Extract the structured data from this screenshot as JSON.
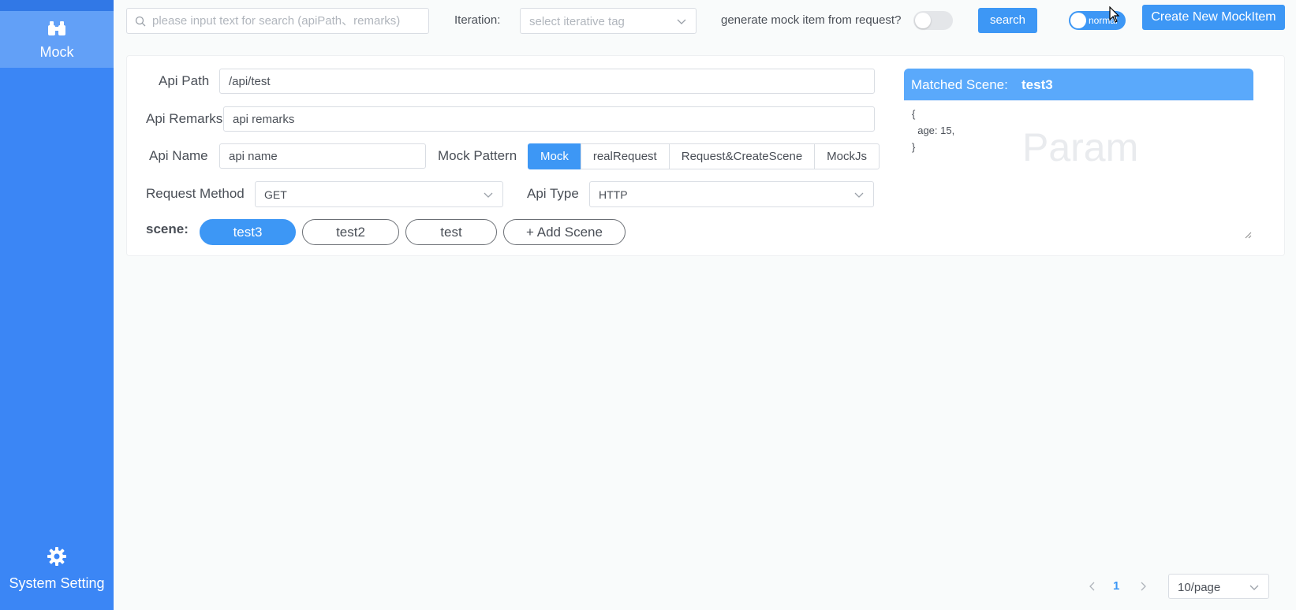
{
  "sidebar": {
    "items": [
      {
        "label": "Mock",
        "icon": "binoculars-icon"
      },
      {
        "label": "System Setting",
        "icon": "gear-icon"
      }
    ]
  },
  "topbar": {
    "search_placeholder": "please input text for search (apiPath、remarks)",
    "search_value": "",
    "iteration_label": "Iteration:",
    "iteration_placeholder": "select iterative tag",
    "generate_label": "generate mock item from request?",
    "generate_enabled": false,
    "search_button": "search",
    "mode_switch_text": "normal",
    "mode_switch_on": true,
    "create_button": "Create New MockItem"
  },
  "item": {
    "api_path_label": "Api Path",
    "api_path_value": "/api/test",
    "api_remarks_label": "Api Remarks",
    "api_remarks_value": "api remarks",
    "api_name_label": "Api Name",
    "api_name_value": "api name",
    "mock_pattern_label": "Mock Pattern",
    "mock_patterns": [
      "Mock",
      "realRequest",
      "Request&CreateScene",
      "MockJs"
    ],
    "mock_pattern_selected": "Mock",
    "request_method_label": "Request Method",
    "request_method_value": "GET",
    "api_type_label": "Api Type",
    "api_type_value": "HTTP",
    "scene_label": "scene:",
    "scenes": [
      "test3",
      "test2",
      "test"
    ],
    "scene_selected": "test3",
    "add_scene": "+ Add Scene"
  },
  "matched": {
    "title": "Matched Scene:",
    "scene": "test3",
    "code": "{\n  age: 15,\n}",
    "watermark": "Param"
  },
  "pagination": {
    "current": "1",
    "page_size": "10/page"
  },
  "colors": {
    "sidebar": "#3b86f5",
    "sidebar_active": "#62a0f7",
    "primary": "#3d97f5",
    "matched_header": "#5aa9fb"
  }
}
